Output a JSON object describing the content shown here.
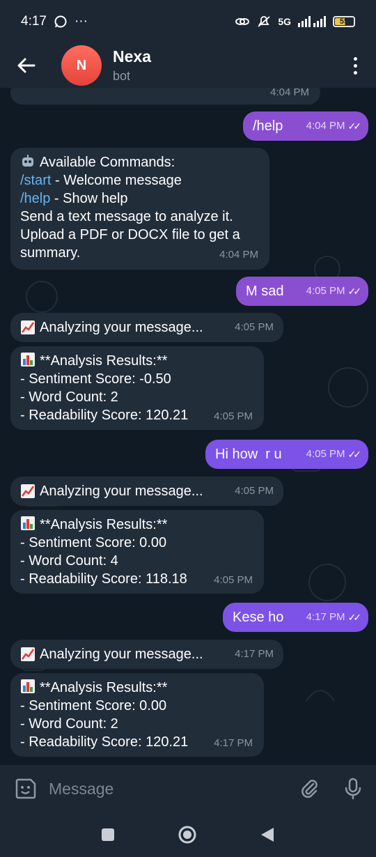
{
  "status_bar": {
    "time": "4:17",
    "more": "···",
    "network": "5G",
    "battery": "55"
  },
  "header": {
    "avatar_letter": "N",
    "title": "Nexa",
    "subtitle": "bot"
  },
  "messages": [
    {
      "side": "in",
      "partial": true,
      "time": "4:04 PM"
    },
    {
      "side": "out",
      "text": "/help",
      "time": "4:04 PM",
      "ticks": "✓✓"
    },
    {
      "side": "in",
      "icon": "robot-icon",
      "line1": "Available Commands:",
      "cmd1": "/start",
      "cmd1_desc": " - Welcome message",
      "cmd2": "/help",
      "cmd2_desc": " - Show help",
      "line4": "Send a text message to analyze it.",
      "line5": "Upload a PDF or DOCX file to get a",
      "line6": "summary.",
      "time": "4:04 PM"
    },
    {
      "side": "out",
      "text": "M sad",
      "time": "4:05 PM",
      "ticks": "✓✓"
    },
    {
      "side": "in",
      "icon": "chart-increasing-icon",
      "text": "Analyzing your message...",
      "time": "4:05 PM"
    },
    {
      "side": "in",
      "icon": "bar-chart-icon",
      "line1": "**Analysis Results:**",
      "line2": "- Sentiment Score: -0.50",
      "line3": "- Word Count: 2",
      "line4": "- Readability Score: 120.21",
      "time": "4:05 PM"
    },
    {
      "side": "out",
      "text": "Hi how  r u",
      "time": "4:05 PM",
      "ticks": "✓✓"
    },
    {
      "side": "in",
      "icon": "chart-increasing-icon",
      "text": "Analyzing your message...",
      "time": "4:05 PM"
    },
    {
      "side": "in",
      "icon": "bar-chart-icon",
      "line1": "**Analysis Results:**",
      "line2": "- Sentiment Score: 0.00",
      "line3": "- Word Count: 4",
      "line4": "- Readability Score: 118.18",
      "time": "4:05 PM"
    },
    {
      "side": "out",
      "text": "Kese ho",
      "time": "4:17 PM",
      "ticks": "✓✓"
    },
    {
      "side": "in",
      "icon": "chart-increasing-icon",
      "text": "Analyzing your message...",
      "time": "4:17 PM"
    },
    {
      "side": "in",
      "icon": "bar-chart-icon",
      "line1": "**Analysis Results:**",
      "line2": "- Sentiment Score: 0.00",
      "line3": "- Word Count: 2",
      "line4": "- Readability Score: 120.21",
      "time": "4:17 PM"
    }
  ],
  "input": {
    "placeholder": "Message"
  },
  "colors": {
    "background": "#0f1a24",
    "bar": "#1d2733",
    "incoming_bubble": "#222d3a",
    "outgoing_bubble": "#8a4fd1",
    "link": "#64b5ef",
    "avatar": "#e5433b"
  }
}
